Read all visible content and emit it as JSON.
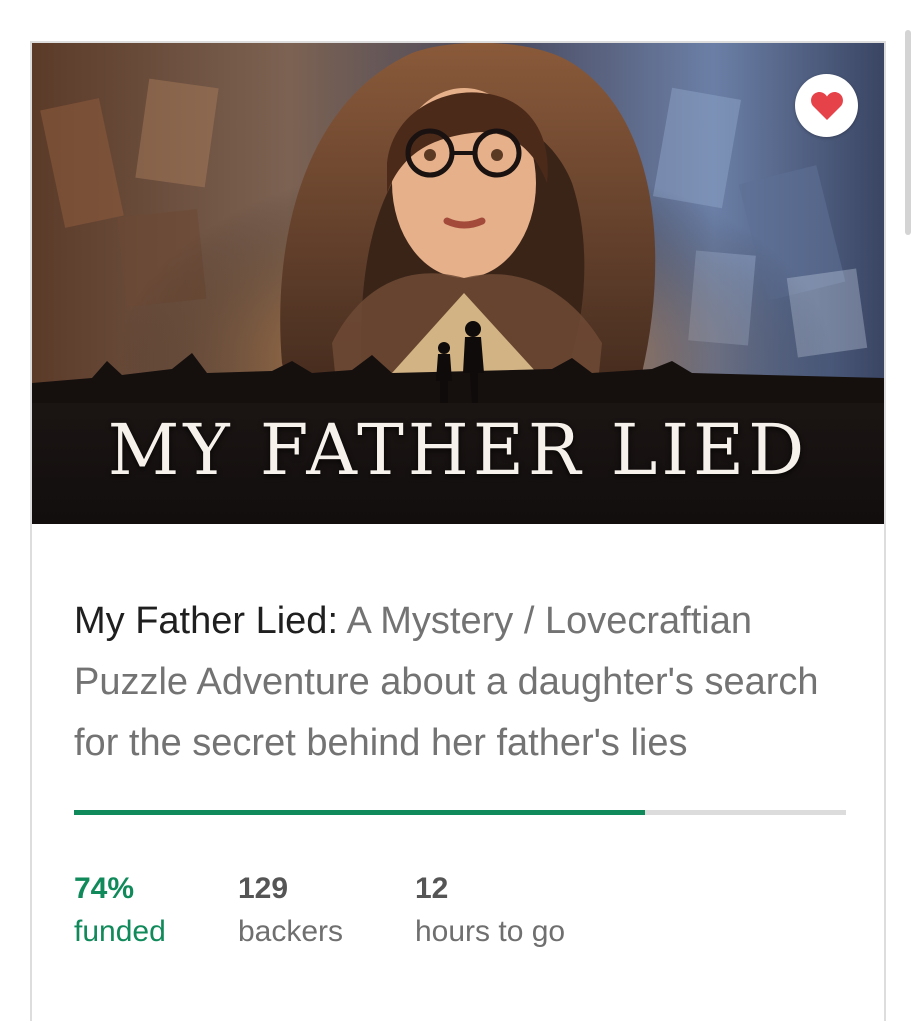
{
  "project": {
    "image_title": "MY FATHER LIED",
    "title": "My Father Lied:",
    "blurb": " A Mystery / Lovecraftian Puzzle Adventure about a daughter's search for the secret behind her father's lies",
    "funded_fraction": 0.74,
    "stats": {
      "funded_value": "74%",
      "funded_label": "funded",
      "backers_value": "129",
      "backers_label": "backers",
      "time_value": "12",
      "time_label": "hours to go"
    }
  },
  "icons": {
    "favorite": "heart-icon"
  },
  "colors": {
    "progress": "#108a5a",
    "progress_track": "#dcdcdc",
    "heart": "#e6424a"
  }
}
